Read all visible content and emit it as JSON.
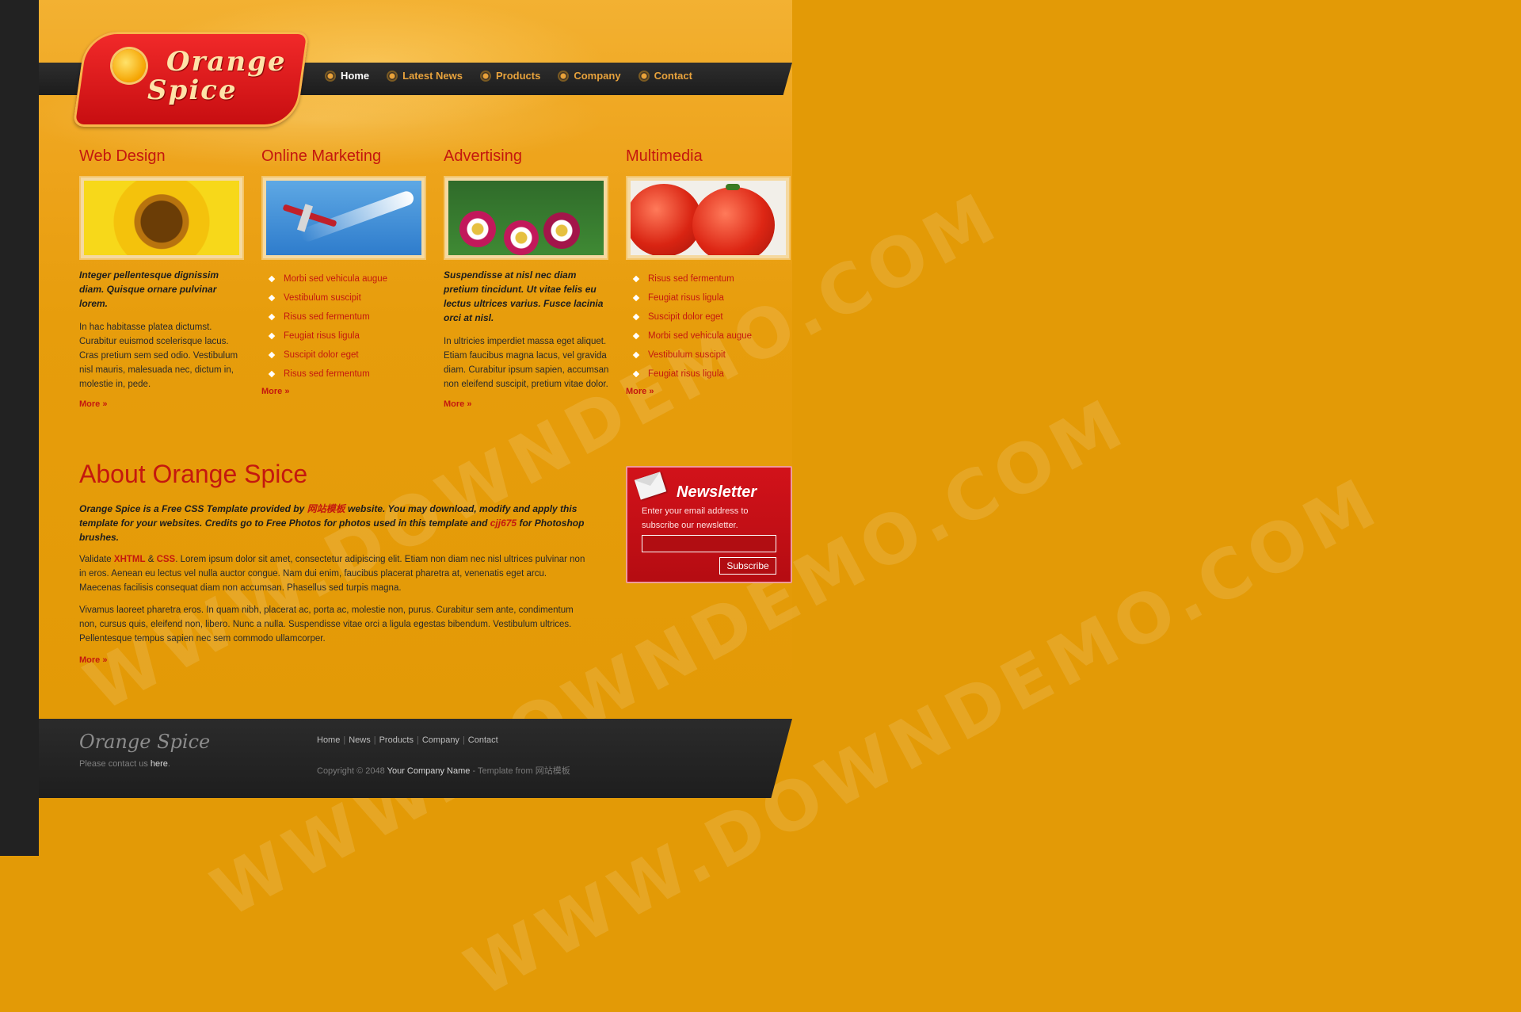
{
  "logo": {
    "line1": "Orange",
    "line2": "Spice"
  },
  "nav": [
    {
      "label": "Home"
    },
    {
      "label": "Latest News"
    },
    {
      "label": "Products"
    },
    {
      "label": "Company"
    },
    {
      "label": "Contact"
    }
  ],
  "columns": {
    "web_design": {
      "title": "Web Design",
      "intro": "Integer pellentesque dignissim diam. Quisque ornare pulvinar lorem.",
      "body": "In hac habitasse platea dictumst. Curabitur euismod scelerisque lacus. Cras pretium sem sed odio. Vestibulum nisl mauris, malesuada nec, dictum in, molestie in, pede.",
      "more": "More »"
    },
    "online_marketing": {
      "title": "Online Marketing",
      "items": [
        "Morbi sed vehicula augue",
        "Vestibulum suscipit",
        "Risus sed fermentum",
        "Feugiat risus ligula",
        "Suscipit dolor eget",
        "Risus sed fermentum"
      ],
      "more": "More »"
    },
    "advertising": {
      "title": "Advertising",
      "intro": "Suspendisse at nisl nec diam pretium tincidunt. Ut vitae felis eu lectus ultrices varius. Fusce lacinia orci at nisl.",
      "body": "In ultricies imperdiet massa eget aliquet. Etiam faucibus magna lacus, vel gravida diam. Curabitur ipsum sapien, accumsan non eleifend suscipit, pretium vitae dolor.",
      "more": "More »"
    },
    "multimedia": {
      "title": "Multimedia",
      "items": [
        "Risus sed fermentum",
        "Feugiat risus ligula",
        "Suscipit dolor eget",
        "Morbi sed vehicula augue",
        "Vestibulum suscipit",
        "Feugiat risus ligula"
      ],
      "more": "More »"
    }
  },
  "about": {
    "title": "About Orange Spice",
    "intro_a": "Orange Spice is a Free CSS Template provided by ",
    "intro_link1": "网站模板",
    "intro_b": " website. You may download, modify and apply this template for your websites. Credits go to Free Photos for photos used in this template and ",
    "intro_link2": "cjj675",
    "intro_c": " for Photoshop brushes.",
    "validate_a": "Validate ",
    "xhtml": "XHTML",
    "amp": " & ",
    "css": "CSS",
    "validate_b": ". Lorem ipsum dolor sit amet, consectetur adipiscing elit. Etiam non diam nec nisl ultrices pulvinar non in eros. Aenean eu lectus vel nulla auctor congue. Nam dui enim, faucibus placerat pharetra at, venenatis eget arcu. Maecenas facilisis consequat diam non accumsan. Phasellus sed turpis magna.",
    "para2": "Vivamus laoreet pharetra eros. In quam nibh, placerat ac, porta ac, molestie non, purus. Curabitur sem ante, condimentum non, cursus quis, eleifend non, libero. Nunc a nulla. Suspendisse vitae orci a ligula egestas bibendum. Vestibulum ultrices. Pellentesque tempus sapien nec sem commodo ullamcorper.",
    "more": "More »"
  },
  "newsletter": {
    "title": "Newsletter",
    "description": "Enter your email address to subscribe our newsletter.",
    "input_value": "",
    "button": "Subscribe"
  },
  "footer": {
    "logo": "Orange Spice",
    "contact_prefix": "Please contact us ",
    "contact_link": "here",
    "contact_suffix": ".",
    "links": [
      "Home",
      "News",
      "Products",
      "Company",
      "Contact"
    ],
    "separator": "|",
    "copyright_prefix": "Copyright © 2048 ",
    "company": "Your Company Name",
    "template_from": " - Template from ",
    "template_site": "网站模板"
  },
  "watermark": "WWW.DOWNDEMO.COM",
  "colors": {
    "accent": "#c4180f",
    "background": "#e39a06",
    "dark": "#222222"
  }
}
